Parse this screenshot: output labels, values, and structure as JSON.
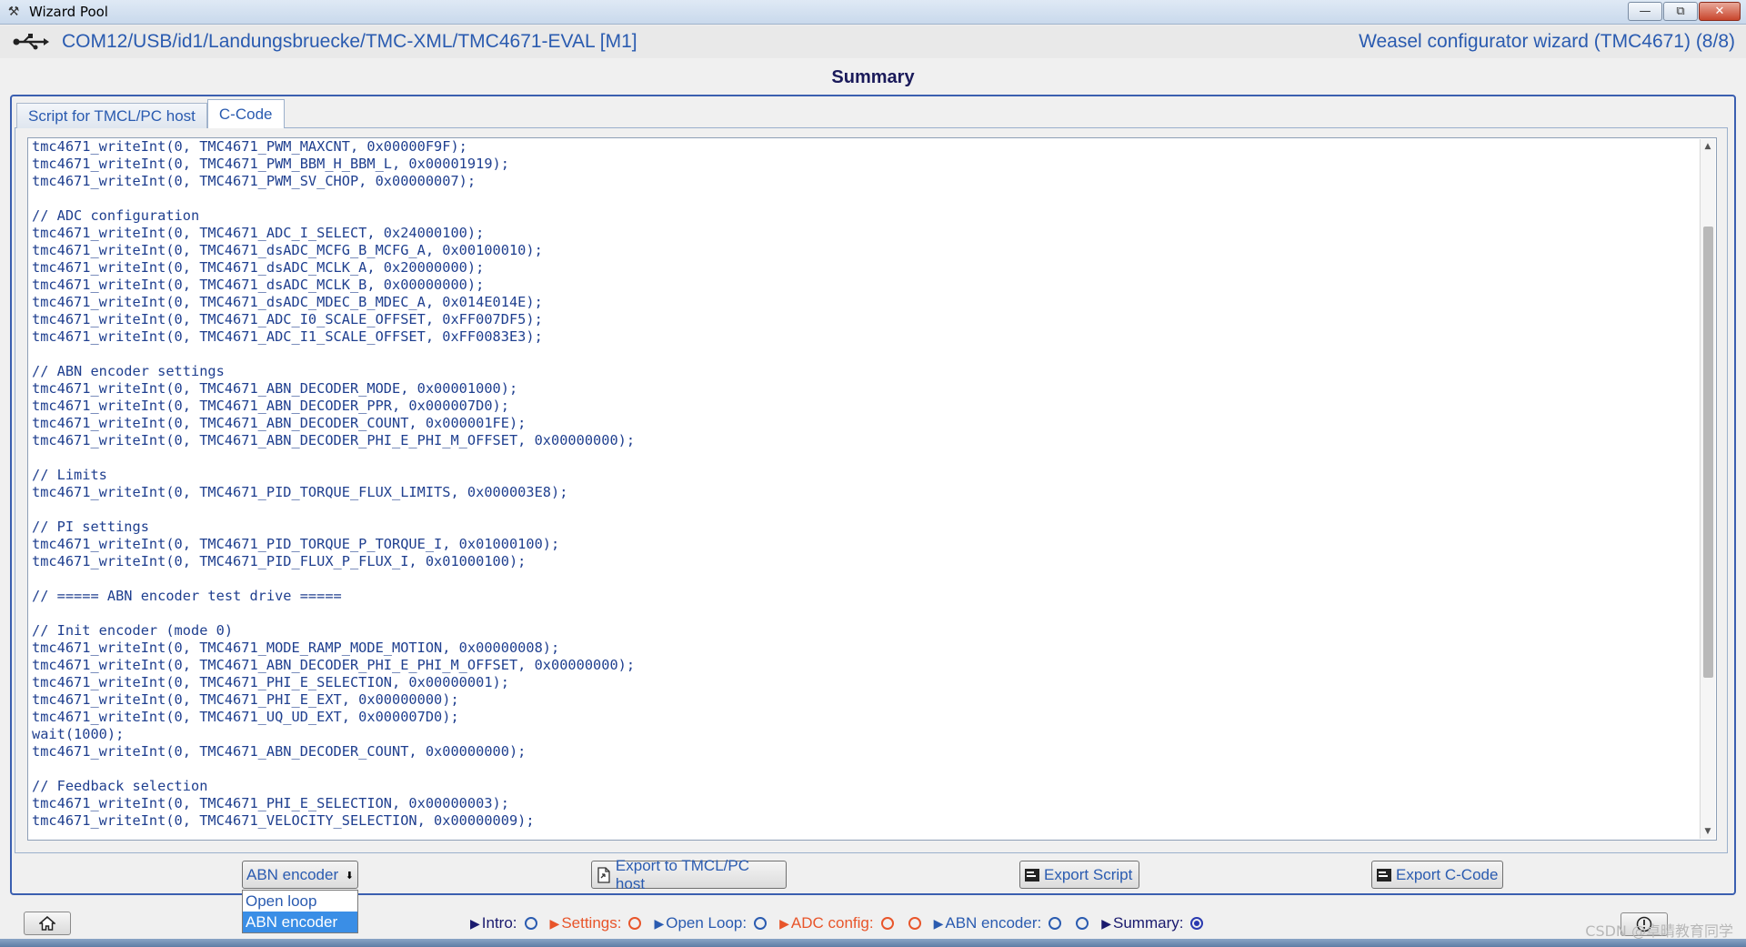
{
  "window": {
    "title": "Wizard Pool",
    "buttons": {
      "minimize": "—",
      "maximize": "⧉",
      "close": "✕"
    }
  },
  "header": {
    "path": "COM12/USB/id1/Landungsbruecke/TMC-XML/TMC4671-EVAL [M1]",
    "wizard_title": "Weasel configurator wizard (TMC4671) (8/8)"
  },
  "page": {
    "heading": "Summary"
  },
  "tabs": [
    {
      "label": "Script for TMCL/PC host",
      "active": false
    },
    {
      "label": "C-Code",
      "active": true
    }
  ],
  "code": {
    "lines": [
      "tmc4671_writeInt(0, TMC4671_PWM_MAXCNT, 0x00000F9F);",
      "tmc4671_writeInt(0, TMC4671_PWM_BBM_H_BBM_L, 0x00001919);",
      "tmc4671_writeInt(0, TMC4671_PWM_SV_CHOP, 0x00000007);",
      "",
      "// ADC configuration",
      "tmc4671_writeInt(0, TMC4671_ADC_I_SELECT, 0x24000100);",
      "tmc4671_writeInt(0, TMC4671_dsADC_MCFG_B_MCFG_A, 0x00100010);",
      "tmc4671_writeInt(0, TMC4671_dsADC_MCLK_A, 0x20000000);",
      "tmc4671_writeInt(0, TMC4671_dsADC_MCLK_B, 0x00000000);",
      "tmc4671_writeInt(0, TMC4671_dsADC_MDEC_B_MDEC_A, 0x014E014E);",
      "tmc4671_writeInt(0, TMC4671_ADC_I0_SCALE_OFFSET, 0xFF007DF5);",
      "tmc4671_writeInt(0, TMC4671_ADC_I1_SCALE_OFFSET, 0xFF0083E3);",
      "",
      "// ABN encoder settings",
      "tmc4671_writeInt(0, TMC4671_ABN_DECODER_MODE, 0x00001000);",
      "tmc4671_writeInt(0, TMC4671_ABN_DECODER_PPR, 0x000007D0);",
      "tmc4671_writeInt(0, TMC4671_ABN_DECODER_COUNT, 0x000001FE);",
      "tmc4671_writeInt(0, TMC4671_ABN_DECODER_PHI_E_PHI_M_OFFSET, 0x00000000);",
      "",
      "// Limits",
      "tmc4671_writeInt(0, TMC4671_PID_TORQUE_FLUX_LIMITS, 0x000003E8);",
      "",
      "// PI settings",
      "tmc4671_writeInt(0, TMC4671_PID_TORQUE_P_TORQUE_I, 0x01000100);",
      "tmc4671_writeInt(0, TMC4671_PID_FLUX_P_FLUX_I, 0x01000100);",
      "",
      "// ===== ABN encoder test drive =====",
      "",
      "// Init encoder (mode 0)",
      "tmc4671_writeInt(0, TMC4671_MODE_RAMP_MODE_MOTION, 0x00000008);",
      "tmc4671_writeInt(0, TMC4671_ABN_DECODER_PHI_E_PHI_M_OFFSET, 0x00000000);",
      "tmc4671_writeInt(0, TMC4671_PHI_E_SELECTION, 0x00000001);",
      "tmc4671_writeInt(0, TMC4671_PHI_E_EXT, 0x00000000);",
      "tmc4671_writeInt(0, TMC4671_UQ_UD_EXT, 0x000007D0);",
      "wait(1000);",
      "tmc4671_writeInt(0, TMC4671_ABN_DECODER_COUNT, 0x00000000);",
      "",
      "// Feedback selection",
      "tmc4671_writeInt(0, TMC4671_PHI_E_SELECTION, 0x00000003);",
      "tmc4671_writeInt(0, TMC4671_VELOCITY_SELECTION, 0x00000009);"
    ]
  },
  "controls": {
    "mode_select": {
      "value": "ABN encoder",
      "options": [
        "Open loop",
        "ABN encoder"
      ]
    },
    "export_tmcl_label": "Export to TMCL/PC host",
    "export_script_label": "Export Script",
    "export_ccode_label": "Export C-Code"
  },
  "steps": [
    {
      "label": "Intro:",
      "color": "#1a1a6e"
    },
    {
      "label": "Settings:",
      "color": "#e8552a"
    },
    {
      "label": "Open Loop:",
      "color": "#2a5bb0"
    },
    {
      "label": "ADC config:",
      "color": "#e8552a"
    },
    {
      "label": "ABN encoder:",
      "color": "#2a5bb0"
    },
    {
      "label": "Summary:",
      "color": "#1a1a6e"
    }
  ],
  "watermark": "CSDN @卓晴教育同学",
  "colors": {
    "accent": "#2a5bb0",
    "frame": "#3b5fb0",
    "selection": "#3a8ee6"
  }
}
